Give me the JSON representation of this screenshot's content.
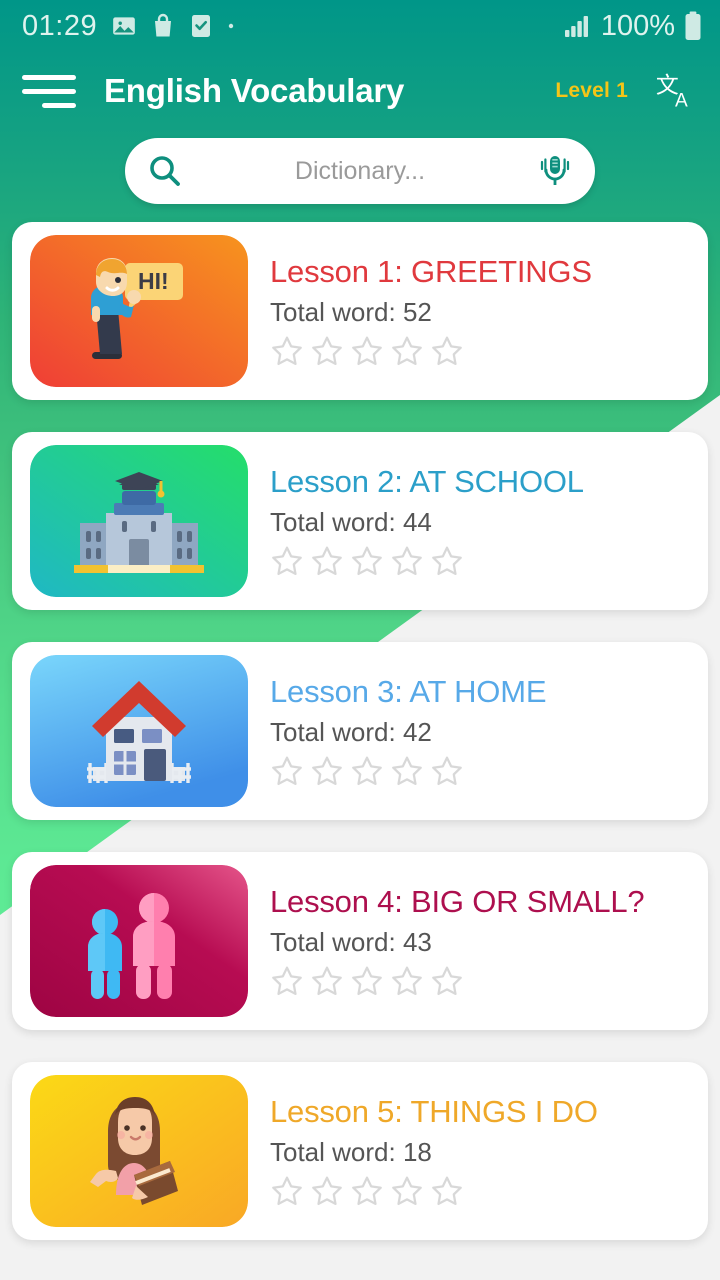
{
  "status_bar": {
    "time": "01:29",
    "battery_text": "100%",
    "left_icons": [
      "image-icon",
      "shopping-bag-icon",
      "checkbox-icon",
      "dot-icon"
    ],
    "right_icons": [
      "signal-bars-icon",
      "battery-icon"
    ]
  },
  "app_bar": {
    "menu_icon": "hamburger-menu-icon",
    "title": "English Vocabulary",
    "level_label": "Level 1",
    "translate_icon": "translate-icon"
  },
  "search": {
    "icon": "search-icon",
    "value": "",
    "placeholder": "Dictionary...",
    "mic_icon": "microphone-icon"
  },
  "colors": {
    "header_top": "#009688",
    "header_bottom": "#62ee98",
    "page_background": "#f2f2f2",
    "card_background": "#ffffff",
    "level_accent": "#f5c518",
    "star_empty": "#d8d8d8",
    "subtitle": "#555555"
  },
  "lessons": [
    {
      "title": "Lesson 1: GREETINGS",
      "title_color": "#e0393e",
      "subtitle": "Total word: 52",
      "word_count": 52,
      "rating": 0,
      "max_rating": 5,
      "thumb_icon": "greeting-man-icon",
      "thumb_gradient_from": "#ef3e36",
      "thumb_gradient_to": "#f7901e",
      "speech_text": "HI!"
    },
    {
      "title": "Lesson 2: AT SCHOOL",
      "title_color": "#2b9fc9",
      "subtitle": "Total word: 44",
      "word_count": 44,
      "rating": 0,
      "max_rating": 5,
      "thumb_icon": "school-building-icon",
      "thumb_gradient_from": "#1ec773",
      "thumb_gradient_to": "#1fb8c4"
    },
    {
      "title": "Lesson 3: AT HOME",
      "title_color": "#57a9e8",
      "subtitle": "Total word: 42",
      "word_count": 42,
      "rating": 0,
      "max_rating": 5,
      "thumb_icon": "house-icon",
      "thumb_gradient_from": "#76d3f9",
      "thumb_gradient_to": "#3f8fe8"
    },
    {
      "title": "Lesson 4: BIG OR SMALL?",
      "title_color": "#ad0f4e",
      "subtitle": "Total word: 43",
      "word_count": 43,
      "rating": 0,
      "max_rating": 5,
      "thumb_icon": "two-people-icon",
      "thumb_gradient_from": "#a30545",
      "thumb_gradient_to": "#e0417b"
    },
    {
      "title": "Lesson 5: THINGS I DO",
      "title_color": "#efa829",
      "subtitle": "Total word: 18",
      "word_count": 18,
      "rating": 0,
      "max_rating": 5,
      "thumb_icon": "woman-reading-icon",
      "thumb_gradient_from": "#fbd916",
      "thumb_gradient_to": "#f9a826"
    }
  ]
}
